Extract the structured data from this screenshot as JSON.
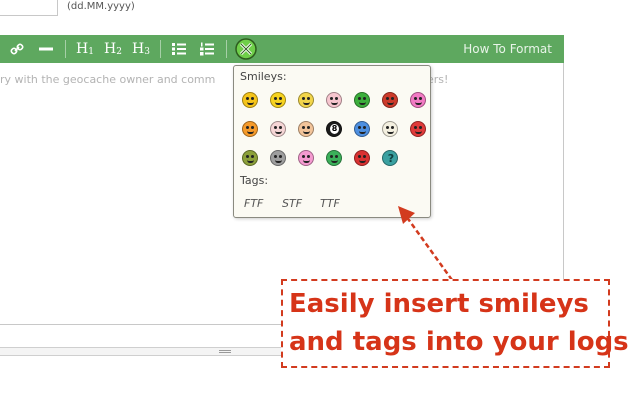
{
  "form": {
    "date_hint": "(dd.MM.yyyy)"
  },
  "toolbar": {
    "icons": [
      "link-icon",
      "horizontal-rule-icon",
      "heading-1-icon",
      "heading-2-icon",
      "heading-3-icon",
      "bulleted-list-icon",
      "numbered-list-icon",
      "smiley-picker-icon"
    ],
    "h1_label": "H",
    "h1_num": "1",
    "h2_label": "H",
    "h2_num": "2",
    "h3_label": "H",
    "h3_num": "3",
    "how_to_label": "How To Format",
    "background_color": "#5ea85f"
  },
  "editor": {
    "placeholder": "ry with the geocache owner and comm"
  },
  "placeholder_tail": "ers!",
  "smiley_popup": {
    "smileys_label": "Smileys:",
    "tags_label": "Tags:",
    "smileys": [
      {
        "name": "big-smile",
        "color": "#f5c41a"
      },
      {
        "name": "cool",
        "color": "#f7d31f"
      },
      {
        "name": "shades",
        "color": "#f2d54a"
      },
      {
        "name": "blush",
        "color": "#f7c6cf"
      },
      {
        "name": "green-face",
        "color": "#3cae3c"
      },
      {
        "name": "devil",
        "color": "#cc3a2a"
      },
      {
        "name": "surprised",
        "color": "#f27ac4"
      },
      {
        "name": "wink",
        "color": "#f59a2a"
      },
      {
        "name": "clown",
        "color": "#f6d6d6"
      },
      {
        "name": "thinking",
        "color": "#f2c49a"
      },
      {
        "name": "8-ball",
        "color": "#1b1b1b"
      },
      {
        "name": "sad-blue",
        "color": "#4d8fe0"
      },
      {
        "name": "dizzy",
        "color": "#f4f0e0"
      },
      {
        "name": "angry",
        "color": "#e03a3a"
      },
      {
        "name": "sick",
        "color": "#8ca03a"
      },
      {
        "name": "grey",
        "color": "#9e9e9e"
      },
      {
        "name": "kiss",
        "color": "#f59ad0"
      },
      {
        "name": "frown",
        "color": "#3bb05a"
      },
      {
        "name": "tongue",
        "color": "#d93232"
      },
      {
        "name": "question",
        "color": "#3aa0a0"
      }
    ],
    "tags": [
      "FTF",
      "STF",
      "TTF"
    ]
  },
  "annotation": {
    "text": "Easily insert smileys\nand tags into your logs",
    "color": "#d63418"
  }
}
